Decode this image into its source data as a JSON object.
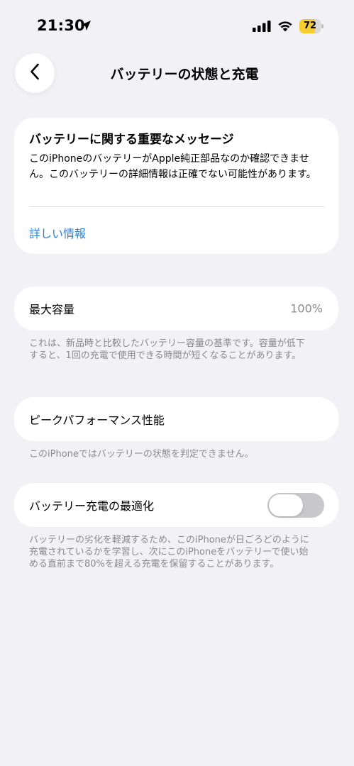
{
  "status_bar": {
    "time": "21:30",
    "battery_level": "72",
    "icons": [
      "location-arrow-icon",
      "cellular-signal-icon",
      "wifi-icon",
      "battery-icon"
    ],
    "battery_color": "#f5cd2f"
  },
  "nav": {
    "back_icon": "chevron-left-icon",
    "title": "バッテリーの状態と充電"
  },
  "alert": {
    "title": "バッテリーに関する重要なメッセージ",
    "body": "このiPhoneのバッテリーがApple純正部品なのか確認できません。このバッテリーの詳細情報は正確でない可能性があります。",
    "link": "詳しい情報",
    "link_color": "#2f7ed8"
  },
  "capacity": {
    "label": "最大容量",
    "value": "100%",
    "note": "これは、新品時と比較したバッテリー容量の基準です。容量が低下すると、1回の充電で使用できる時間が短くなることがあります。"
  },
  "performance": {
    "label": "ピークパフォーマンス性能",
    "note": "このiPhoneではバッテリーの状態を判定できません。"
  },
  "optimize": {
    "label": "バッテリー充電の最適化",
    "toggle_on": false,
    "note": "バッテリーの劣化を軽減するため、このiPhoneが日ごろどのように充電されているかを学習し、次にこのiPhoneをバッテリーで使い始める直前まで80%を超える充電を保留することがあります。"
  },
  "colors": {
    "background": "#f2f1f6",
    "card": "#ffffff",
    "secondary_text": "#8a8a8e",
    "toggle_off": "#c8c7cc"
  }
}
